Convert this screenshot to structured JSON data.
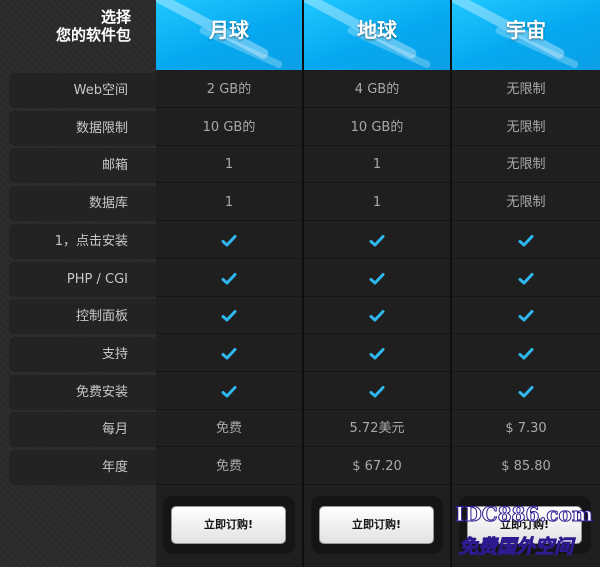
{
  "header": {
    "corner_line1": "选择",
    "corner_line2": "您的软件包",
    "plans": [
      "月球",
      "地球",
      "宇宙"
    ]
  },
  "rows": [
    {
      "label": "Web空间",
      "values": [
        "2 GB的",
        "4 GB的",
        "无限制"
      ]
    },
    {
      "label": "数据限制",
      "values": [
        "10 GB的",
        "10 GB的",
        "无限制"
      ]
    },
    {
      "label": "邮箱",
      "values": [
        "1",
        "1",
        "无限制"
      ]
    },
    {
      "label": "数据库",
      "values": [
        "1",
        "1",
        "无限制"
      ]
    },
    {
      "label": "1，点击安装",
      "values": [
        "check",
        "check",
        "check"
      ]
    },
    {
      "label": "PHP / CGI",
      "values": [
        "check",
        "check",
        "check"
      ]
    },
    {
      "label": "控制面板",
      "values": [
        "check",
        "check",
        "check"
      ]
    },
    {
      "label": "支持",
      "values": [
        "check",
        "check",
        "check"
      ]
    },
    {
      "label": "免费安装",
      "values": [
        "check",
        "check",
        "check"
      ]
    },
    {
      "label": "每月",
      "values": [
        "免费",
        "5.72美元",
        "$ 7.30"
      ]
    },
    {
      "label": "年度",
      "values": [
        "免费",
        "$ 67.20",
        "$ 85.80"
      ]
    }
  ],
  "buttons": {
    "order_label": "立即订购!"
  },
  "icons": {
    "check": "checkmark-icon"
  },
  "colors": {
    "header_blue": "#06a8f0",
    "check_blue": "#2fb8ef"
  },
  "watermark": {
    "line1": "IDC886.com",
    "line2": "免费国外空间"
  }
}
